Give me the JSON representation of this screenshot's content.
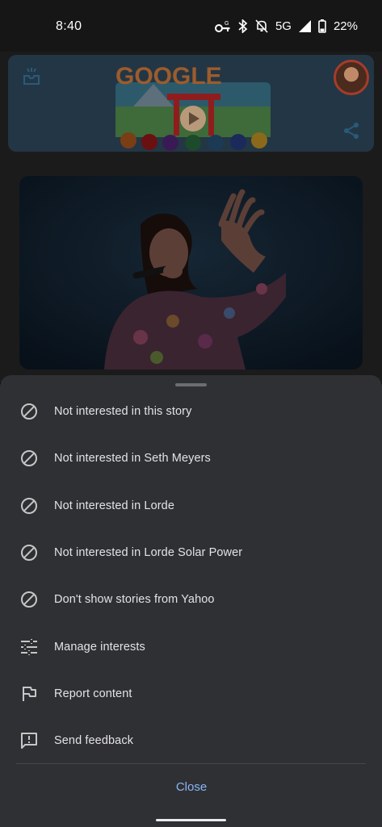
{
  "status_bar": {
    "time": "8:40",
    "network": "5G",
    "battery": "22%",
    "icons": [
      "vpn-key-icon",
      "bluetooth-icon",
      "notifications-off-icon",
      "signal-icon",
      "battery-icon"
    ]
  },
  "doodle": {
    "logo_text": "GOOGLE"
  },
  "menu": {
    "items": [
      {
        "label": "Not interested in this story",
        "icon": "block-icon"
      },
      {
        "label": "Not interested in Seth Meyers",
        "icon": "block-icon"
      },
      {
        "label": "Not interested in Lorde",
        "icon": "block-icon"
      },
      {
        "label": "Not interested in Lorde Solar Power",
        "icon": "block-icon"
      },
      {
        "label": "Don't show stories from Yahoo",
        "icon": "block-icon"
      },
      {
        "label": "Manage interests",
        "icon": "tune-icon"
      },
      {
        "label": "Report content",
        "icon": "flag-icon"
      },
      {
        "label": "Send feedback",
        "icon": "feedback-icon"
      }
    ],
    "close_label": "Close"
  },
  "colors": {
    "sheet_background": "#2f3033",
    "accent": "#8ab4f8",
    "text": "#e3e3e6",
    "icon": "#c4c7c5"
  }
}
